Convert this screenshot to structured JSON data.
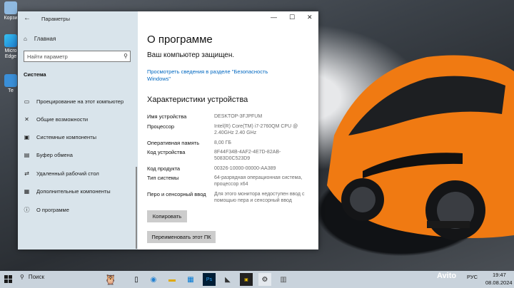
{
  "desktop": {
    "icons": [
      {
        "label": "Корзи"
      },
      {
        "label": "Micro Edge"
      },
      {
        "label": "Те"
      }
    ]
  },
  "window": {
    "title": "Параметры",
    "controls": {
      "minimize": "—",
      "maximize": "☐",
      "close": "✕"
    }
  },
  "sidebar": {
    "home": "Главная",
    "search_placeholder": "Найти параметр",
    "section": "Система",
    "items": [
      {
        "label": "Проецирование на этот компьютер",
        "icon": "projector-icon"
      },
      {
        "label": "Общие возможности",
        "icon": "shared-icon"
      },
      {
        "label": "Системные компоненты",
        "icon": "components-icon"
      },
      {
        "label": "Буфер обмена",
        "icon": "clipboard-icon"
      },
      {
        "label": "Удаленный рабочий стол",
        "icon": "remote-desktop-icon"
      },
      {
        "label": "Дополнительные компоненты",
        "icon": "optional-features-icon"
      },
      {
        "label": "О программе",
        "icon": "info-icon"
      }
    ]
  },
  "main": {
    "title": "О программе",
    "protected": "Ваш компьютер защищен.",
    "security_link": "Просмотреть сведения в разделе \"Безопасность Windows\"",
    "specs_title": "Характеристики устройства",
    "specs": [
      {
        "label": "Имя устройства",
        "value": "DESKTOP-3FJPFUM"
      },
      {
        "label": "Процессор",
        "value": "Intel(R) Core(TM) i7-2760QM CPU @ 2.40GHz   2.40 GHz"
      },
      {
        "label": "Оперативная память",
        "value": "8,00 ГБ"
      },
      {
        "label": "Код устройства",
        "value": "8F44F34B-4AF2-4E7D-82AB-5083D0C523D9"
      },
      {
        "label": "Код продукта",
        "value": "00326-10000-00000-AA389"
      },
      {
        "label": "Тип системы",
        "value": "64-разрядная операционная система, процессор x64"
      },
      {
        "label": "Перо и сенсорный ввод",
        "value": "Для этого монитора недоступен ввод с помощью пера и сенсорный ввод"
      }
    ],
    "copy_button": "Копировать",
    "rename_button": "Переименовать этот ПК"
  },
  "taskbar": {
    "search": "Поиск",
    "language": "РУС",
    "time": "19:47",
    "date": "08.08.2024"
  },
  "watermark": "Avito",
  "colors": {
    "accent": "#0067c0",
    "sidebar": "#d6e2ea",
    "taskbar": "#c9d3dc"
  }
}
